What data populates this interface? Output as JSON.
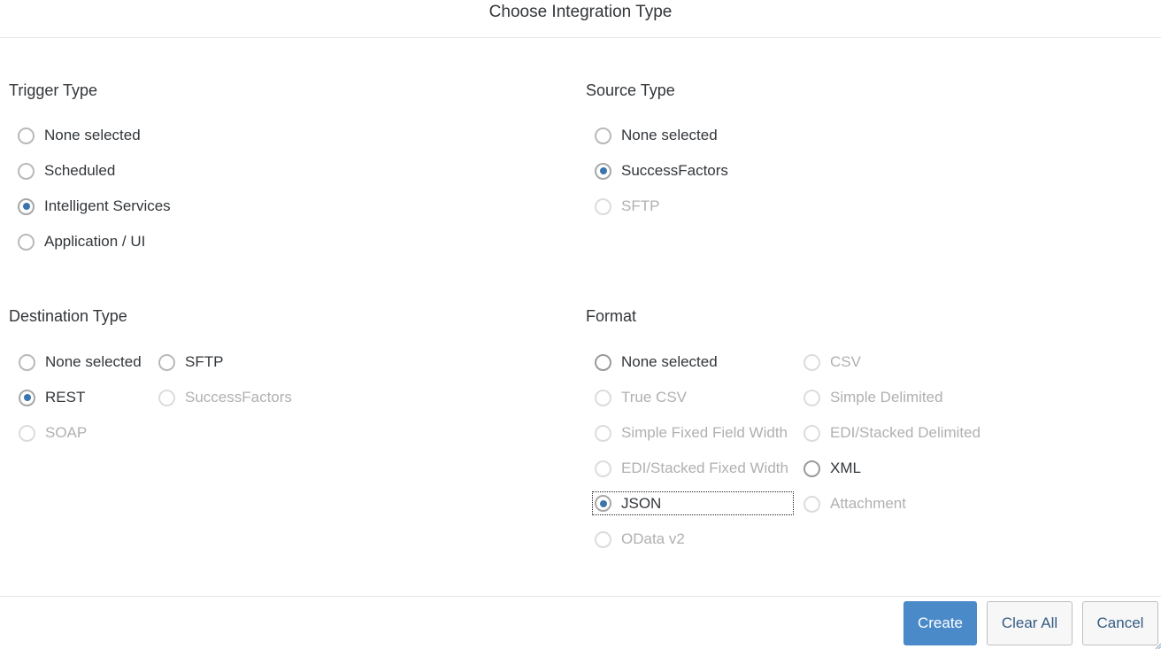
{
  "dialog": {
    "title": "Choose Integration Type"
  },
  "sections": {
    "trigger": {
      "title": "Trigger Type",
      "options": [
        {
          "label": "None selected",
          "state": "enabled",
          "selected": false
        },
        {
          "label": "Scheduled",
          "state": "enabled",
          "selected": false
        },
        {
          "label": "Intelligent Services",
          "state": "enabled",
          "selected": true
        },
        {
          "label": "Application / UI",
          "state": "enabled",
          "selected": false
        }
      ]
    },
    "source": {
      "title": "Source Type",
      "options": [
        {
          "label": "None selected",
          "state": "enabled",
          "selected": false
        },
        {
          "label": "SuccessFactors",
          "state": "enabled",
          "selected": true
        },
        {
          "label": "SFTP",
          "state": "disabled",
          "selected": false
        }
      ]
    },
    "destination": {
      "title": "Destination Type",
      "options": [
        {
          "label": "None selected",
          "state": "enabled",
          "selected": false
        },
        {
          "label": "SFTP",
          "state": "enabled",
          "selected": false
        },
        {
          "label": "REST",
          "state": "enabled",
          "selected": true
        },
        {
          "label": "SuccessFactors",
          "state": "disabled",
          "selected": false
        },
        {
          "label": "SOAP",
          "state": "disabled",
          "selected": false
        }
      ]
    },
    "format": {
      "title": "Format",
      "options": [
        {
          "label": "None selected",
          "state": "enabled",
          "selected": false
        },
        {
          "label": "CSV",
          "state": "disabled",
          "selected": false
        },
        {
          "label": "True CSV",
          "state": "disabled",
          "selected": false
        },
        {
          "label": "Simple Delimited",
          "state": "disabled",
          "selected": false
        },
        {
          "label": "Simple Fixed Field Width",
          "state": "disabled",
          "selected": false
        },
        {
          "label": "EDI/Stacked Delimited",
          "state": "disabled",
          "selected": false
        },
        {
          "label": "EDI/Stacked Fixed Width",
          "state": "disabled",
          "selected": false
        },
        {
          "label": "XML",
          "state": "enabled",
          "selected": false
        },
        {
          "label": "JSON",
          "state": "enabled",
          "selected": true,
          "focused": true
        },
        {
          "label": "Attachment",
          "state": "disabled",
          "selected": false
        },
        {
          "label": "OData v2",
          "state": "disabled",
          "selected": false
        }
      ]
    }
  },
  "footer": {
    "create_label": "Create",
    "clear_all_label": "Clear All",
    "cancel_label": "Cancel"
  },
  "colors": {
    "primary": "#4a8ac9",
    "radio_selected_dot": "#3a75ad",
    "secondary_text": "#345c84",
    "disabled_text": "#b0b0b0"
  }
}
